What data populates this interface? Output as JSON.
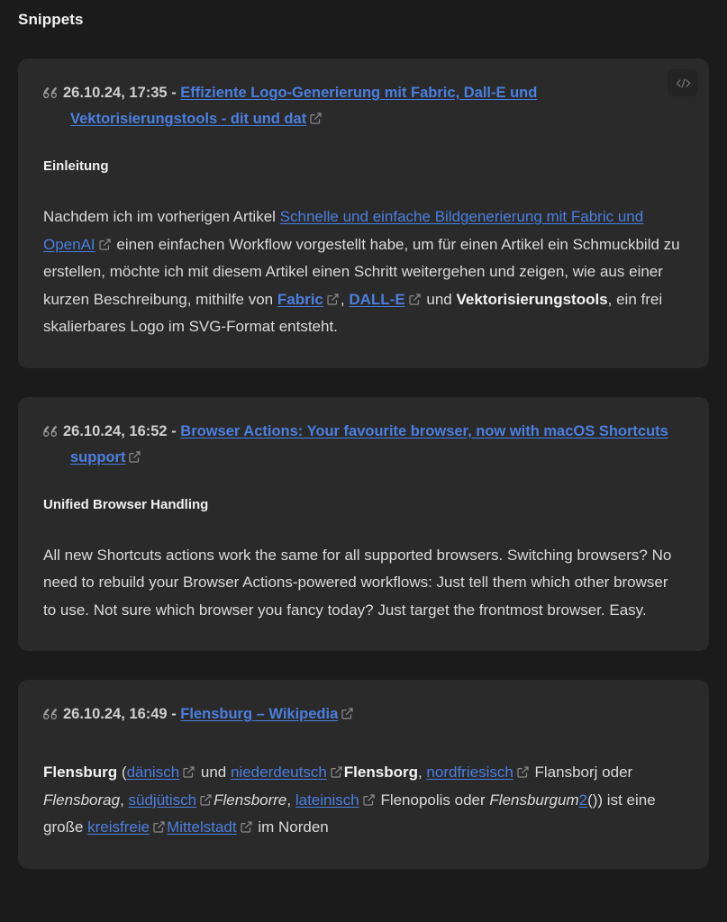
{
  "page": {
    "title": "Snippets",
    "background_color": "#1b1b1b",
    "card_color": "#2a2a2a",
    "link_color": "#4b7fe0",
    "text_color": "#dadada"
  },
  "icons": {
    "quote": "quote-icon",
    "external_link": "external-link-icon",
    "code": "code-icon"
  },
  "snippets": [
    {
      "id": "snippet-1",
      "date": "26.10.24, 17:35",
      "separator": "-",
      "source_title": "Effiziente Logo-Generierung mit Fabric, Dall-E und Vektorisierungstools - dit und dat",
      "has_code_button": true,
      "heading": "Einleitung",
      "body": {
        "t1": "Nachdem ich im vorherigen Artikel ",
        "l1": "Schnelle und einfache Bildgenerierung mit Fabric und OpenAI",
        "t2": " einen einfachen Workflow vorgestellt habe, um für einen Artikel ein Schmuckbild zu erstellen, möchte ich mit diesem Artikel einen Schritt weitergehen und zeigen, wie aus einer kurzen Beschreibung, mithilfe von ",
        "l2": "Fabric",
        "t3": ", ",
        "l3": "DALL-E",
        "t4": " und ",
        "b1": "Vektorisierungstools",
        "t5": ", ein frei skalierbares Logo im SVG-Format entsteht."
      }
    },
    {
      "id": "snippet-2",
      "date": "26.10.24, 16:52",
      "separator": "-",
      "source_title": "Browser Actions: Your favourite browser, now with macOS Shortcuts support",
      "has_code_button": false,
      "heading": "Unified Browser Handling",
      "body": {
        "t1": "All new Shortcuts actions work the same for all supported browsers. Switching browsers? No need to rebuild your Browser Actions-powered workflows: Just tell them which other browser to use. Not sure which browser you fancy today? Just target the frontmost browser. Easy."
      }
    },
    {
      "id": "snippet-3",
      "date": "26.10.24, 16:49",
      "separator": "-",
      "source_title": "Flensburg – Wikipedia",
      "has_code_button": false,
      "heading": "",
      "body": {
        "b1": "Flensburg",
        "t1": " (",
        "l1": "dänisch",
        "t2": " und ",
        "l2": "niederdeutsch",
        "b2": "Flensborg",
        "t3": ", ",
        "l3": "nordfriesisch",
        "t4": " Flansborj oder ",
        "i1": "Flensborag",
        "t5": ", ",
        "l4": "südjütisch",
        "i2": "Flensborre",
        "t6": ", ",
        "l5": "lateinisch",
        "t7": " Flenopolis oder ",
        "i3": "Flensburgum",
        "ref": "2",
        "t8": "()) ist eine große ",
        "l6": "kreisfreie",
        "l7": "Mittelstadt",
        "t9": " im Norden"
      }
    }
  ]
}
